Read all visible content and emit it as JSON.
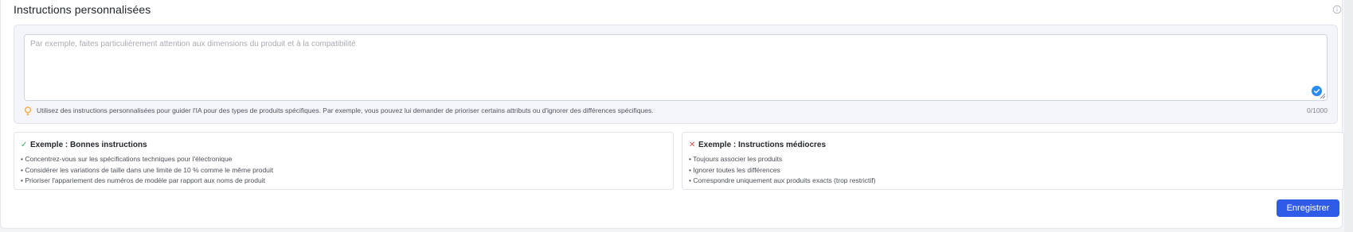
{
  "section": {
    "title": "Instructions personnalisées",
    "info_icon": "info-circle-icon"
  },
  "instructions": {
    "placeholder": "Par exemple, faites particulièrement attention aux dimensions du produit et à la compatibilité",
    "value": "",
    "hint": "Utilisez des instructions personnalisées pour guider l'IA pour des types de produits spécifiques. Par exemple, vous pouvez lui demander de prioriser certains attributs ou d'ignorer des différences spécifiques.",
    "counter": "0/1000",
    "hint_icon": "lightbulb-icon",
    "accent_color": "#f0a43a"
  },
  "examples": {
    "good": {
      "mark": "✓",
      "title": "Exemple : Bonnes instructions",
      "items": [
        "• Concentrez-vous sur les spécifications techniques pour l'électronique",
        "• Considérer les variations de taille dans une limite de 10 % comme le même produit",
        "• Prioriser l'appariement des numéros de modèle par rapport aux noms de produit"
      ],
      "color": "#2fae6b"
    },
    "bad": {
      "mark": "✕",
      "title": "Exemple : Instructions médiocres",
      "items": [
        "• Toujours associer les produits",
        "• Ignorer toutes les différences",
        "• Correspondre uniquement aux produits exacts (trop restrictif)"
      ],
      "color": "#e05050"
    }
  },
  "actions": {
    "save_label": "Enregistrer",
    "save_color": "#2e5be8"
  }
}
